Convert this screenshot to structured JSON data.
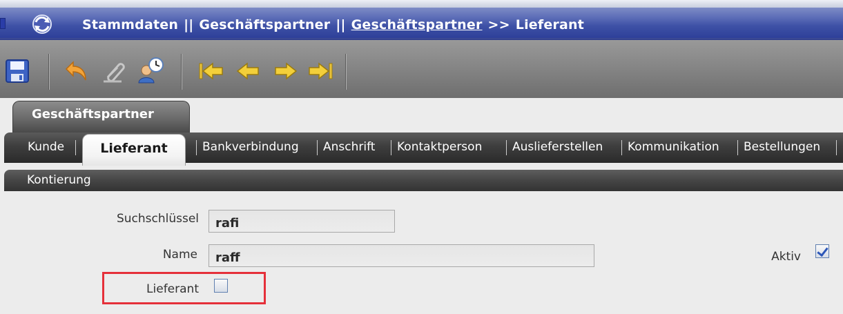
{
  "titlebar": {
    "crumbs": [
      "Stammdaten",
      "Geschäftspartner",
      "Geschäftspartner",
      "Lieferant"
    ],
    "separator": "||",
    "arrow": ">>"
  },
  "toolbar": {
    "buttons": [
      "save-icon",
      "undo-icon",
      "attach-icon",
      "user-clock-icon",
      "first-record-icon",
      "previous-record-icon",
      "next-record-icon",
      "last-record-icon"
    ]
  },
  "group_tab": {
    "label": "Geschäftspartner"
  },
  "subtabs": {
    "items": [
      "Kunde",
      "Lieferant",
      "Bankverbindung",
      "Anschrift",
      "Kontaktperson",
      "Auslieferstellen",
      "Kommunikation",
      "Bestellungen"
    ],
    "active": "Lieferant"
  },
  "section": {
    "label": "Kontierung"
  },
  "form": {
    "suchschluessel_label": "Suchschlüssel",
    "suchschluessel_value": "rafi",
    "name_label": "Name",
    "name_value": "raff",
    "aktiv_label": "Aktiv",
    "aktiv_checked": true,
    "lieferant_label": "Lieferant",
    "lieferant_checked": false
  },
  "colors": {
    "title_blue": "#2e4099",
    "highlight_red": "#e5303a",
    "checkbox_border": "#5f7fb0"
  }
}
